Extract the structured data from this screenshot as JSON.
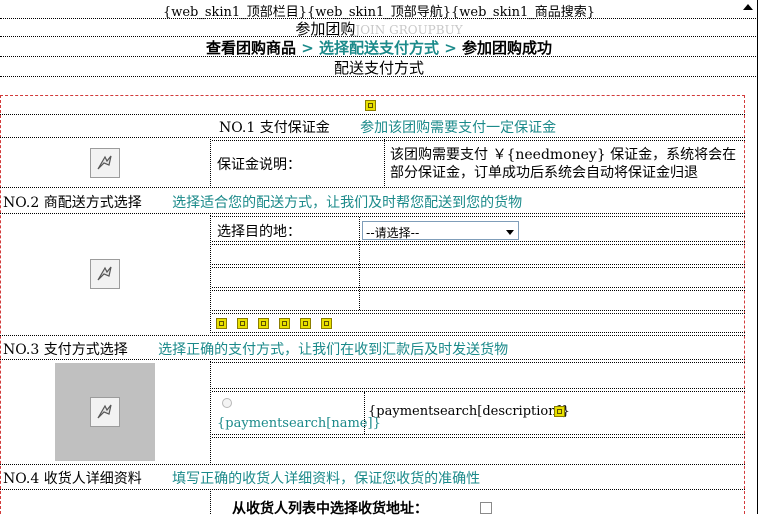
{
  "top_bar": {
    "text": "{web_skin1_顶部栏目}{web_skin1_顶部导航}{web_skin1_商品搜索}"
  },
  "header": {
    "title": "参加团购",
    "title_en": "JOIN GROUPBUY",
    "steps": {
      "step1": "查看团购商品",
      "sep1": " > ",
      "step2": "选择配送支付方式",
      "sep2": " > ",
      "step3": "参加团购成功"
    },
    "subtitle": "配送支付方式"
  },
  "sections": {
    "no1": {
      "title": "NO.1 支付保证金",
      "hint": "参加该团购需要支付一定保证金",
      "label": "保证金说明：",
      "desc_line1": "该团购需要支付 ￥{needmoney} 保证金，系统将会在",
      "desc_line2": "部分保证金，订单成功后系统会自动将保证金归退"
    },
    "no2": {
      "title": "NO.2 商配送方式选择",
      "hint": "选择适合您的配送方式，让我们及时帮您配送到您的货物",
      "dest_label": "选择目的地：",
      "dest_selected": "--请选择--"
    },
    "no3": {
      "title": "NO.3 支付方式选择",
      "hint": "选择正确的支付方式，让我们在收到汇款后及时发送货物",
      "payment_name": "{paymentsearch[name]}",
      "payment_desc": "{paymentsearch[description]}"
    },
    "no4": {
      "title": "NO.4 收货人详细资料",
      "hint": "填写正确的收货人详细资料，保证您收货的准确性",
      "address_pick": "从收货人列表中选择收货地址："
    }
  },
  "icons": {
    "small_gif": "broken-gif-icon",
    "image_placeholder": "broken-image-icon"
  },
  "colors": {
    "teal": "#1b8a8a",
    "red_border": "#d23a3a",
    "gray_box": "#c0c0c0"
  }
}
